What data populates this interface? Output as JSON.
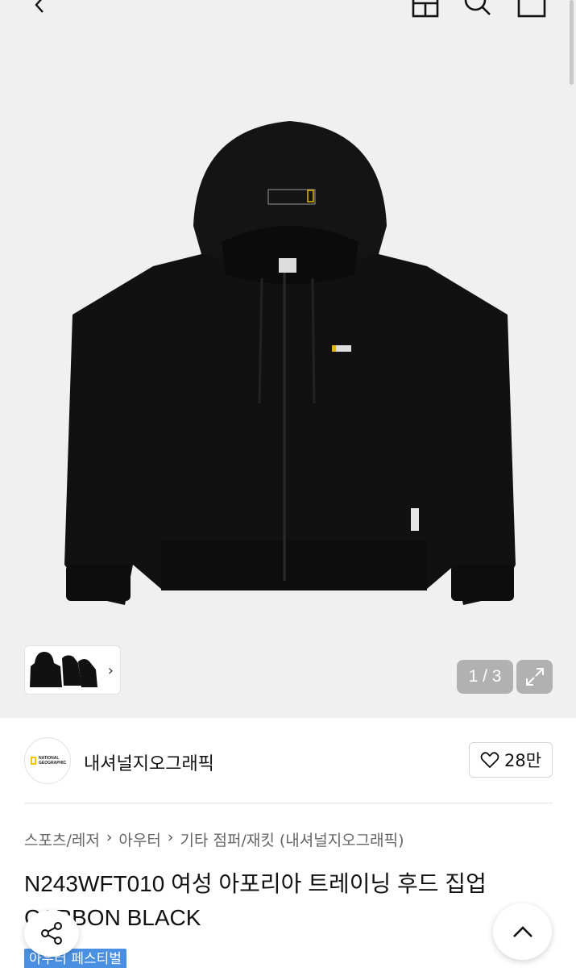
{
  "header": {
    "back_icon": "chevron-left-icon",
    "home_icon": "home-icon",
    "search_icon": "search-icon",
    "cart_icon": "bag-icon"
  },
  "gallery": {
    "counter": "1 / 3",
    "expand_icon": "expand-icon",
    "thumb_chevron": "›"
  },
  "brand": {
    "name": "내셔널지오그래픽",
    "logo_text": "NATIONAL GEOGRAPHIC",
    "like_count": "28만"
  },
  "breadcrumb": [
    "스포츠/레저",
    "아우터",
    "기타 점퍼/재킷 (내셔널지오그래픽)"
  ],
  "product": {
    "title": "N243WFT010 여성 아포리아 트레이닝 후드 집업 CARBON BLACK"
  },
  "badge": "아우터 페스티벌",
  "colors": {
    "accent": "#4a90e2",
    "brand_yellow": "#f2c500",
    "counter_bg": "#b1b1b1"
  }
}
